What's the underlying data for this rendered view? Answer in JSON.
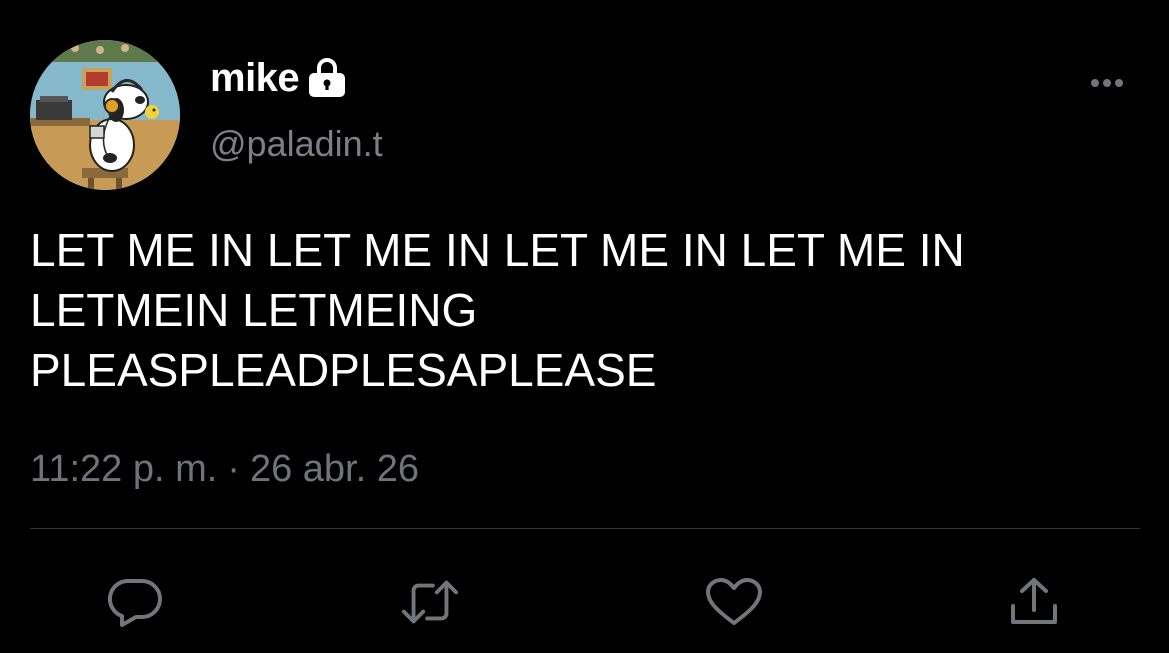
{
  "author": {
    "display_name": "mike",
    "handle": "@paladin.t",
    "protected": true,
    "avatar_icon": "cartoon-dog-avatar"
  },
  "tweet": {
    "text_lines": [
      "LET ME IN LET ME IN LET ME IN LET ME IN",
      "LETMEIN LETMEING",
      "PLEASPLEADPLESAPLEASE"
    ],
    "time": "11:22 p. m.",
    "separator": "·",
    "date": "26 abr. 26"
  },
  "actions": {
    "reply_icon": "reply-icon",
    "retweet_icon": "retweet-icon",
    "like_icon": "heart-icon",
    "share_icon": "share-icon",
    "more_icon": "more-icon"
  },
  "colors": {
    "background": "#000000",
    "primary_text": "#ffffff",
    "secondary_text": "#71767b",
    "icon": "#71767b",
    "divider": "#2f3336"
  }
}
